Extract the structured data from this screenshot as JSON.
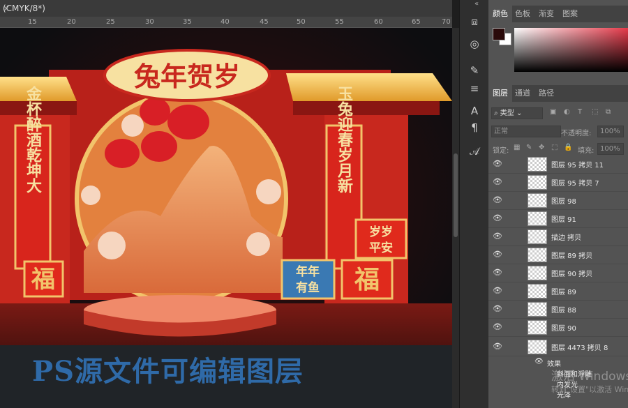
{
  "document": {
    "tab_title": "(CMYK/8*)",
    "tab_close": "×",
    "ruler_ticks": [
      "15",
      "20",
      "25",
      "30",
      "35",
      "40",
      "45",
      "50",
      "55",
      "60",
      "65",
      "70"
    ]
  },
  "artwork": {
    "headline": "兔年贺岁",
    "left_couplet": "金杯醉酒乾坤大",
    "right_couplet": "玉兔迎春岁月新",
    "fu_left": "福",
    "fu_right": "福",
    "sign_blue": "年年有鱼",
    "sign_red": "岁岁平安",
    "overlay_caption": "PS源文件可编辑图层"
  },
  "panels": {
    "color_tabs": [
      "颜色",
      "色板",
      "渐变",
      "图案"
    ],
    "layer_tabs": [
      "图层",
      "通道",
      "路径"
    ],
    "filter_label": "类型",
    "blend_mode": "正常",
    "opacity_label": "不透明度:",
    "opacity_value": "100%",
    "lock_label": "锁定:",
    "fill_label": "填充:",
    "fill_value": "100%",
    "layers": [
      "图层 95 拷贝 11",
      "图层 95 拷贝 7",
      "图层 98",
      "图层 91",
      "描边 拷贝",
      "图层 89 拷贝",
      "图层 90 拷贝",
      "图层 89",
      "图层 88",
      "图层 90",
      "图层 4473 拷贝 8"
    ],
    "effects_label": "效果",
    "effects": [
      "斜面和浮雕",
      "内发光",
      "光泽"
    ]
  },
  "system": {
    "watermark_line1": "激活 Windows",
    "watermark_line2": "转到\"设置\"以激活 Windows。"
  },
  "colors": {
    "accent_red": "#c8281e",
    "gold": "#f2c46b",
    "caption_blue": "#2f6aa8",
    "panel_bg": "#535353"
  }
}
